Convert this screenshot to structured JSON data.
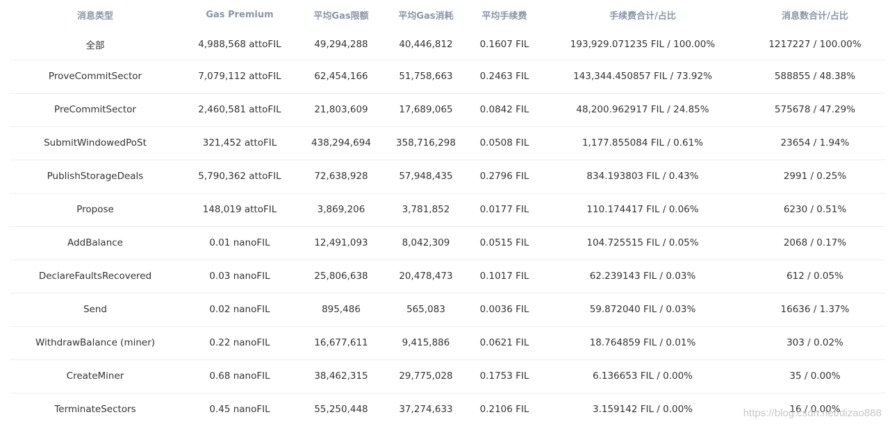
{
  "table": {
    "headers": [
      "消息类型",
      "Gas Premium",
      "平均Gas限额",
      "平均Gas消耗",
      "平均手续费",
      "手续费合计/占比",
      "消息数合计/占比"
    ],
    "rows": [
      [
        "全部",
        "4,988,568 attoFIL",
        "49,294,288",
        "40,446,812",
        "0.1607 FIL",
        "193,929.071235 FIL / 100.00%",
        "1217227 / 100.00%"
      ],
      [
        "ProveCommitSector",
        "7,079,112 attoFIL",
        "62,454,166",
        "51,758,663",
        "0.2463 FIL",
        "143,344.450857 FIL / 73.92%",
        "588855 / 48.38%"
      ],
      [
        "PreCommitSector",
        "2,460,581 attoFIL",
        "21,803,609",
        "17,689,065",
        "0.0842 FIL",
        "48,200.962917 FIL / 24.85%",
        "575678 / 47.29%"
      ],
      [
        "SubmitWindowedPoSt",
        "321,452 attoFIL",
        "438,294,694",
        "358,716,298",
        "0.0508 FIL",
        "1,177.855084 FIL / 0.61%",
        "23654 / 1.94%"
      ],
      [
        "PublishStorageDeals",
        "5,790,362 attoFIL",
        "72,638,928",
        "57,948,435",
        "0.2796 FIL",
        "834.193803 FIL / 0.43%",
        "2991 / 0.25%"
      ],
      [
        "Propose",
        "148,019 attoFIL",
        "3,869,206",
        "3,781,852",
        "0.0177 FIL",
        "110.174417 FIL / 0.06%",
        "6230 / 0.51%"
      ],
      [
        "AddBalance",
        "0.01 nanoFIL",
        "12,491,093",
        "8,042,309",
        "0.0515 FIL",
        "104.725515 FIL / 0.05%",
        "2068 / 0.17%"
      ],
      [
        "DeclareFaultsRecovered",
        "0.03 nanoFIL",
        "25,806,638",
        "20,478,473",
        "0.1017 FIL",
        "62.239143 FIL / 0.03%",
        "612 / 0.05%"
      ],
      [
        "Send",
        "0.02 nanoFIL",
        "895,486",
        "565,083",
        "0.0036 FIL",
        "59.872040 FIL / 0.03%",
        "16636 / 1.37%"
      ],
      [
        "WithdrawBalance (miner)",
        "0.22 nanoFIL",
        "16,677,611",
        "9,415,886",
        "0.0621 FIL",
        "18.764859 FIL / 0.01%",
        "303 / 0.02%"
      ],
      [
        "CreateMiner",
        "0.68 nanoFIL",
        "38,462,315",
        "29,775,028",
        "0.1753 FIL",
        "6.136653 FIL / 0.00%",
        "35 / 0.00%"
      ],
      [
        "TerminateSectors",
        "0.45 nanoFIL",
        "55,250,448",
        "37,274,633",
        "0.2106 FIL",
        "3.159142 FIL / 0.00%",
        "16 / 0.00%"
      ]
    ]
  },
  "watermark": "https://blog.csdn.net/dizao888"
}
